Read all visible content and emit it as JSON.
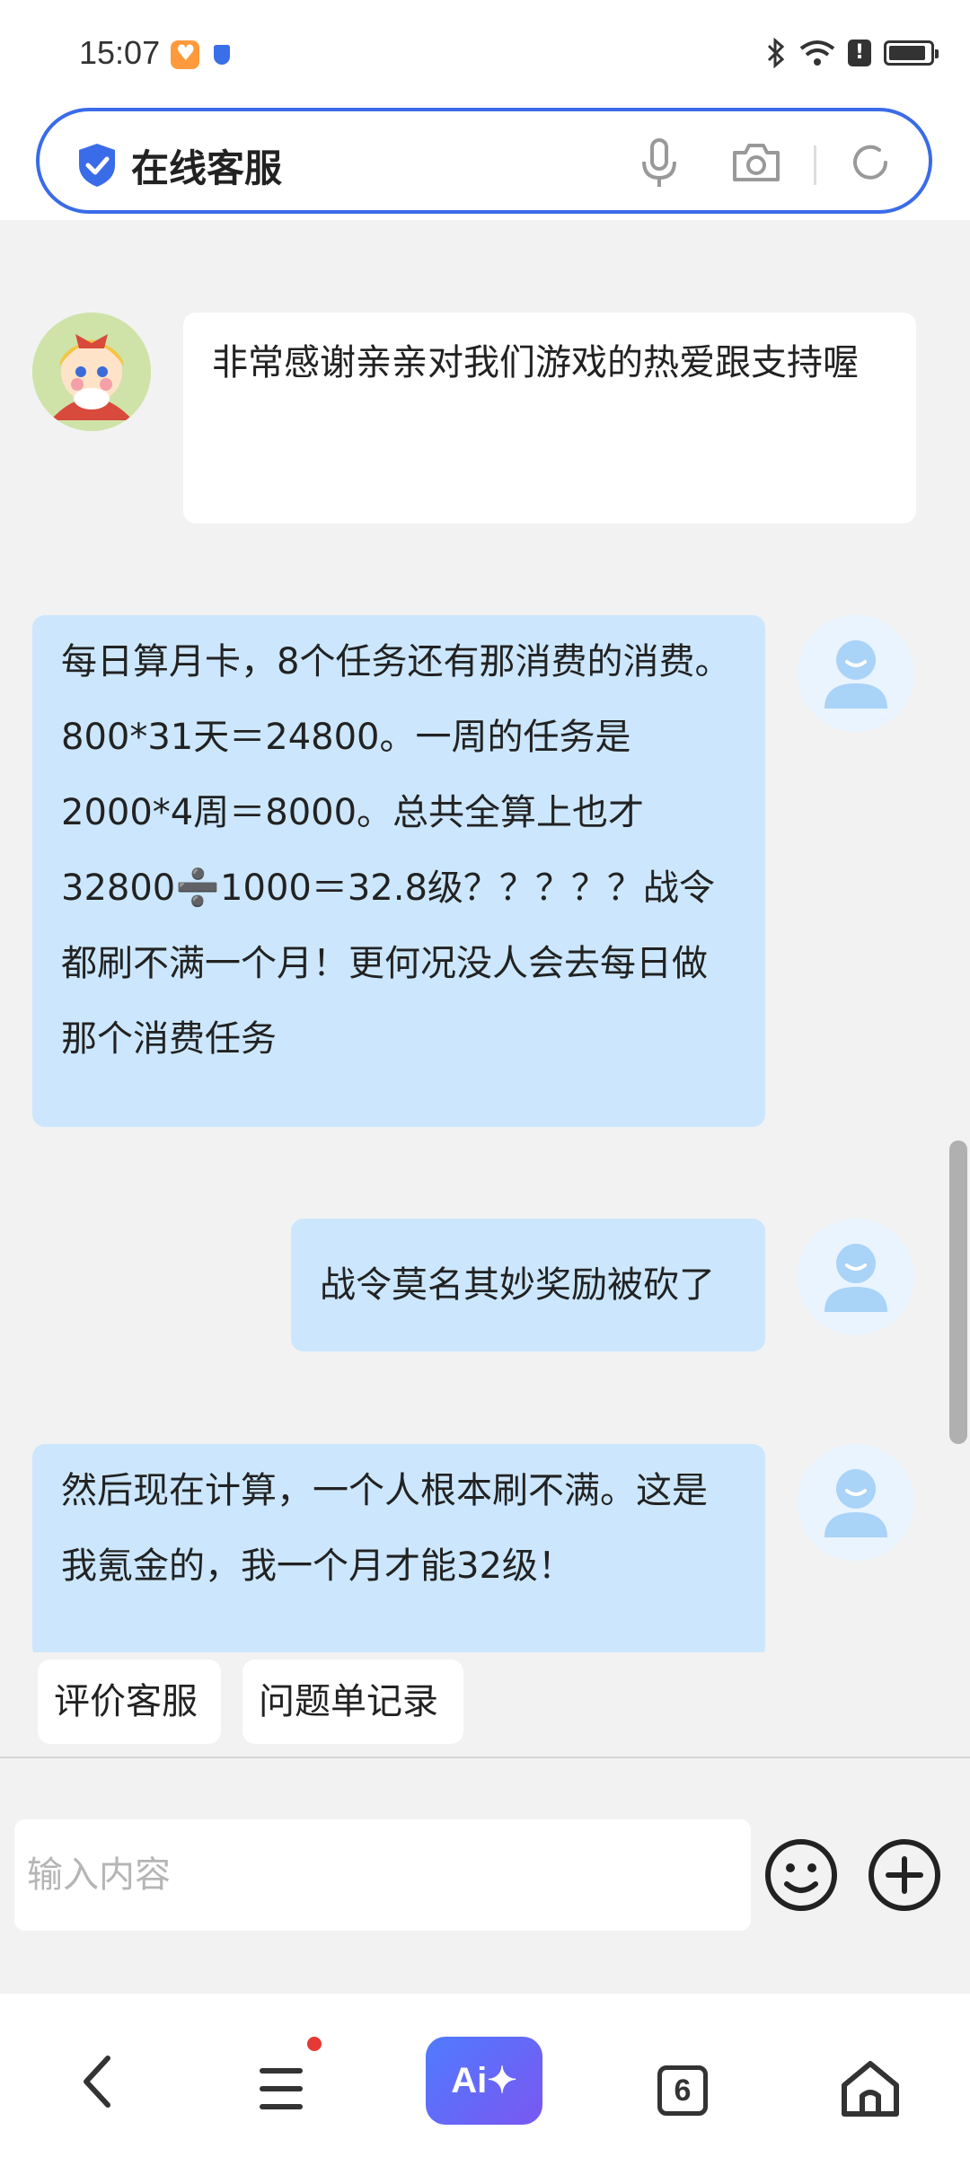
{
  "status_bar": {
    "time": "15:07"
  },
  "search_bar": {
    "title": "在线客服"
  },
  "chat": {
    "messages": [
      {
        "from": "agent",
        "text": "非常感谢亲亲对我们游戏的热爱跟支持喔"
      },
      {
        "from": "user",
        "text": "每日算月卡，8个任务还有那消费的消费。800*31天＝24800。一周的任务是2000*4周＝8000。总共全算上也才32800➗1000＝32.8级？？？？？战令都刷不满一个月！更何况没人会去每日做那个消费任务"
      },
      {
        "from": "user",
        "text": "战令莫名其妙奖励被砍了"
      },
      {
        "from": "user",
        "text": "然后现在计算，一个人根本刷不满。这是我氪金的，我一个月才能32级！"
      }
    ]
  },
  "quick_actions": {
    "rate_service": "评价客服",
    "ticket_records": "问题单记录"
  },
  "input": {
    "placeholder": "输入内容"
  },
  "bottom_nav": {
    "ai_label": "Ai✦",
    "tab_count": "6"
  }
}
